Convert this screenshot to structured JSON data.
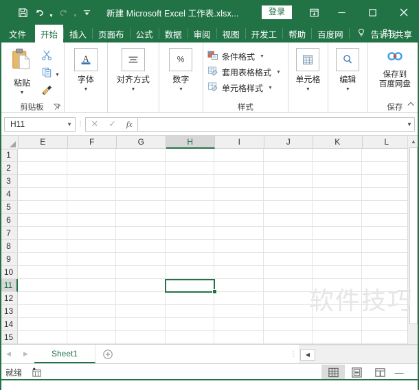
{
  "titlebar": {
    "title": "新建 Microsoft Excel 工作表.xlsx...",
    "signin_label": "登录",
    "qat": [
      {
        "name": "save",
        "icon": "save-icon"
      },
      {
        "name": "undo",
        "icon": "undo-icon"
      },
      {
        "name": "redo",
        "icon": "redo-icon"
      },
      {
        "name": "customize",
        "icon": "customize-qat-icon"
      }
    ],
    "window_controls": {
      "ribbon_display": "ribbon-display-options-icon",
      "minimize": "minimize-icon",
      "maximize": "maximize-icon",
      "close": "close-icon"
    }
  },
  "tabs": [
    {
      "label": "文件",
      "active": false
    },
    {
      "label": "开始",
      "active": true
    },
    {
      "label": "插入",
      "active": false
    },
    {
      "label": "页面布",
      "active": false
    },
    {
      "label": "公式",
      "active": false
    },
    {
      "label": "数据",
      "active": false
    },
    {
      "label": "审阅",
      "active": false
    },
    {
      "label": "视图",
      "active": false
    },
    {
      "label": "开发工",
      "active": false
    },
    {
      "label": "帮助",
      "active": false
    },
    {
      "label": "百度网",
      "active": false
    }
  ],
  "tellme": {
    "label": "告诉我",
    "icon": "lightbulb-icon"
  },
  "share": {
    "label": "共享",
    "icon": "share-person-icon"
  },
  "ribbon": {
    "clipboard": {
      "group_label": "剪贴板",
      "paste_label": "粘贴",
      "cut_name": "cut-icon",
      "copy_name": "copy-icon",
      "format_painter_name": "format-painter-icon"
    },
    "font": {
      "label": "字体",
      "icon": "font-A-icon"
    },
    "alignment": {
      "label": "对齐方式",
      "icon": "alignment-lines-icon"
    },
    "number": {
      "label": "数字",
      "icon": "percent-icon"
    },
    "styles": {
      "group_label": "样式",
      "items": [
        {
          "label": "条件格式",
          "icon": "conditional-formatting-icon"
        },
        {
          "label": "套用表格格式",
          "icon": "format-as-table-icon"
        },
        {
          "label": "单元格样式",
          "icon": "cell-styles-icon"
        }
      ]
    },
    "cells": {
      "label": "单元格",
      "icon": "cells-table-icon"
    },
    "editing": {
      "label": "编辑",
      "icon": "magnifier-icon"
    },
    "save_group": {
      "group_label": "保存",
      "button_line1": "保存到",
      "button_line2": "百度网盘",
      "icon": "baidu-netdisk-icon"
    }
  },
  "formulabar": {
    "namebox_value": "H11",
    "cancel_icon": "cancel-x-icon",
    "confirm_icon": "confirm-check-icon",
    "function_icon": "fx-icon",
    "input_value": "",
    "expand_icon": "expand-formula-bar-icon"
  },
  "grid": {
    "columns": [
      "E",
      "F",
      "G",
      "H",
      "I",
      "J",
      "K",
      "L"
    ],
    "selected_column": "H",
    "rows": [
      "1",
      "2",
      "3",
      "4",
      "5",
      "6",
      "7",
      "8",
      "9",
      "10",
      "11",
      "12",
      "13",
      "14",
      "15"
    ],
    "selected_row": "11",
    "selected_cell": "H11",
    "cell_values": {}
  },
  "watermark": {
    "text": "软件技巧"
  },
  "sheetbar": {
    "prev_icon": "nav-prev-icon",
    "next_icon": "nav-next-icon",
    "sheets": [
      {
        "label": "Sheet1",
        "active": true
      }
    ],
    "add_sheet_icon": "add-sheet-plus-icon",
    "hscroll_left_icon": "hscroll-left-icon"
  },
  "statusbar": {
    "status_text": "就绪",
    "recording_icon": "macro-record-icon",
    "views": [
      {
        "name": "normal-view",
        "icon": "grid-view-icon",
        "active": true
      },
      {
        "name": "page-layout-view",
        "icon": "page-layout-icon",
        "active": false
      },
      {
        "name": "page-break-view",
        "icon": "page-break-icon",
        "active": false
      }
    ],
    "zoom_out_label": "—"
  },
  "colors": {
    "excel_green": "#217346",
    "header_gray": "#f0f0f0",
    "selection_green": "#217346",
    "gridline": "#e4e4e4"
  }
}
